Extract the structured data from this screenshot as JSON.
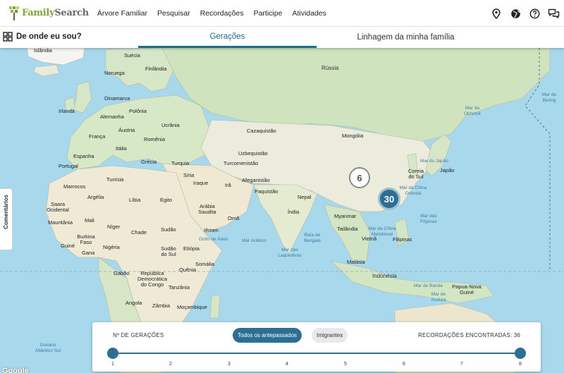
{
  "header": {
    "logo_family": "Family",
    "logo_search": "Search",
    "nav": [
      "Árvore Familiar",
      "Pesquisar",
      "Recordações",
      "Participe",
      "Atividades"
    ],
    "icons": [
      "location-pin-icon",
      "globe-icon",
      "help-icon",
      "chat-icon"
    ]
  },
  "subbar": {
    "title": "De onde eu sou?",
    "tabs": [
      {
        "label": "Gerações",
        "active": true
      },
      {
        "label": "Linhagem da minha família",
        "active": false
      }
    ]
  },
  "map": {
    "labels": {
      "islandia": "Islândia",
      "suecia": "Suécia",
      "finlandia": "Finlândia",
      "russia": "Rússia",
      "noruega": "Noruega",
      "irlanda": "Irlanda",
      "dinamarca": "Dinamarca",
      "polonia": "Polônia",
      "ucrania": "Ucrânia",
      "alemanha": "Alemanha",
      "franca": "França",
      "austria": "Áustria",
      "romenia": "Romênia",
      "italia": "Itália",
      "espanha": "Espanha",
      "portugal": "Portugal",
      "grecia": "Grécia",
      "turquia": "Turquia",
      "cazaquistao": "Cazaquistão",
      "mongolia": "Mongólia",
      "uzbequistao": "Uzbequistão",
      "turcomenistao": "Turcomenistão",
      "tunisia": "Tunísia",
      "siria": "Síria",
      "iraque": "Iraque",
      "ira": "Irã",
      "afeganistao": "Afeganistão",
      "paquistao": "Paquistão",
      "nepal": "Nepal",
      "coreia_do_sul": "Coreia do Sul",
      "japao": "Japão",
      "mar_do_japao": "Mar do Japão",
      "marrocos": "Marrocos",
      "argelia": "Argélia",
      "libia": "Líbia",
      "egito": "Egito",
      "arabia_saudita": "Arábia Saudita",
      "oma": "Omã",
      "india": "Índia",
      "mar_china_oriental": "Mar da China Oriental",
      "saara_ocidental": "Saara Ocidental",
      "mauritania": "Mauritânia",
      "mali": "Mali",
      "niger": "Níger",
      "chade": "Chade",
      "sudao": "Sudão",
      "iemen": "Iêmen",
      "golfo_de_aden": "Golfo de Áden",
      "mar_arabico": "Mar Arábico",
      "baia_de_bengala": "Baía de Bengala",
      "myanmar": "Myanmar",
      "tailandia": "Tailândia",
      "vietna": "Vietnã",
      "filipinas": "Filipinas",
      "mar_filipinas": "Mar das Filipinas",
      "mar_china_meridional": "Mar da China Meridional",
      "burkina_faso": "Burkina Faso",
      "guine": "Guiné",
      "gana": "Gana",
      "nigeria": "Nigéria",
      "sudao_do_sul": "Sudão do Sul",
      "etiopia": "Etiópia",
      "somalia": "Somália",
      "mar_laquedivas": "Mar das Laquedivas",
      "malasia": "Malásia",
      "gabao": "Gabão",
      "rep_dem_congo": "República Democrática do Congo",
      "quenia": "Quênia",
      "tanzania": "Tanzânia",
      "indonesia": "Indonésia",
      "mar_de_banda": "Mar de Banda",
      "papua_nova_guine": "Papua-Nova Guiné",
      "mar_de_arafura": "Mar de Arafura",
      "angola": "Angola",
      "zambia": "Zâmbia",
      "mocambique": "Moçambique",
      "oceano_atlantico_sul": "Oceano Atlântico Sul",
      "mar_de_okhotsk": "Mar de Okhotsk",
      "mar_de_bering": "Mar de Bering"
    },
    "clusters": [
      {
        "count": "6",
        "style": "light"
      },
      {
        "count": "30",
        "style": "dark"
      }
    ],
    "attribution": "Google"
  },
  "feedback_tab": "Comentários",
  "generations_panel": {
    "left_label": "Nº DE GERAÇÕES",
    "filter_all": "Todos os antepassados",
    "filter_immigrants": "Imigrantes",
    "records_label": "RECORDAÇÕES ENCONTRADAS: 36",
    "ticks": [
      "1",
      "2",
      "3",
      "4",
      "5",
      "6",
      "7",
      "8"
    ],
    "range_min": 1,
    "range_max": 8,
    "accent": "#2c6f93"
  }
}
